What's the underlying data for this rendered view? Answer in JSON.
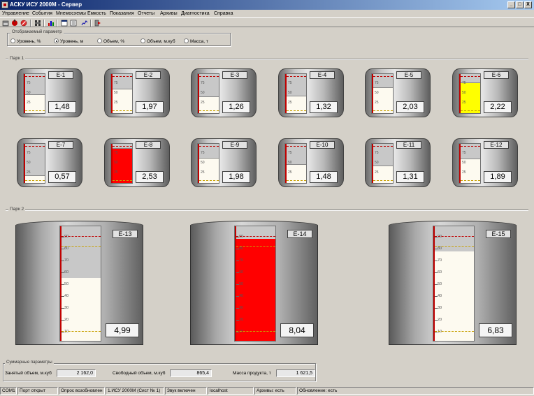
{
  "window": {
    "title": "АСКУ ИСУ 2000М - Сервер",
    "buttons": [
      "_",
      "□",
      "X"
    ]
  },
  "menu": [
    "Управление",
    "События",
    "Мнемосхемы",
    "Емкость",
    "Показания",
    "Отчеты",
    "Архивы",
    "Диагностика",
    "Справка"
  ],
  "toolbar_icons": [
    "tank-icon",
    "red-circle-icon",
    "stop-icon",
    "tools-icon",
    "chart-bars-icon",
    "window-icon",
    "panel-icon",
    "graph-icon",
    "exit-icon"
  ],
  "param_group": {
    "legend": "Отображаемый параметр",
    "options": [
      {
        "label": "Уровень, %",
        "checked": false
      },
      {
        "label": "Уровень, м",
        "checked": true
      },
      {
        "label": "Объем, %",
        "checked": false
      },
      {
        "label": "Объем, м.куб",
        "checked": false
      },
      {
        "label": "Масса, т",
        "checked": false
      }
    ]
  },
  "park1_label": "Парк 1",
  "park2_label": "Парк 2",
  "small_ticks": [
    "75",
    "50",
    "25"
  ],
  "big_ticks": [
    "90",
    "80",
    "70",
    "60",
    "50",
    "40",
    "30",
    "20",
    "10"
  ],
  "park1_tanks": [
    {
      "name": "Е-1",
      "value": "1,48",
      "level": 0.48,
      "color": "#fdfaf0"
    },
    {
      "name": "Е-2",
      "value": "1,97",
      "level": 0.62,
      "color": "#fdfaf0"
    },
    {
      "name": "Е-3",
      "value": "1,26",
      "level": 0.42,
      "color": "#fdfaf0"
    },
    {
      "name": "Е-4",
      "value": "1,32",
      "level": 0.44,
      "color": "#fdfaf0"
    },
    {
      "name": "Е-5",
      "value": "2,03",
      "level": 0.66,
      "color": "#fdfaf0"
    },
    {
      "name": "Е-6",
      "value": "2,22",
      "level": 0.78,
      "color": "#ffff00"
    },
    {
      "name": "Е-7",
      "value": "0,57",
      "level": 0.2,
      "color": "#fdfaf0"
    },
    {
      "name": "Е-8",
      "value": "2,53",
      "level": 0.9,
      "color": "#ff0000"
    },
    {
      "name": "Е-9",
      "value": "1,98",
      "level": 0.65,
      "color": "#fdfaf0"
    },
    {
      "name": "Е-10",
      "value": "1,48",
      "level": 0.48,
      "color": "#fdfaf0"
    },
    {
      "name": "Е-11",
      "value": "1,31",
      "level": 0.44,
      "color": "#fdfaf0"
    },
    {
      "name": "Е-12",
      "value": "1,89",
      "level": 0.62,
      "color": "#fdfaf0"
    }
  ],
  "park2_tanks": [
    {
      "name": "Е-13",
      "value": "4,99",
      "level": 0.55,
      "color": "#fdfaf0"
    },
    {
      "name": "Е-14",
      "value": "8,04",
      "level": 0.89,
      "color": "#ff0000"
    },
    {
      "name": "Е-15",
      "value": "6,83",
      "level": 0.78,
      "color": "#fdfaf0"
    }
  ],
  "summary": {
    "legend": "Суммарные параметры",
    "occupied_label": "Занятый объем, м.куб",
    "occupied_value": "2 162,0",
    "free_label": "Свободный объем, м.куб",
    "free_value": "865,4",
    "mass_label": "Масса продукта, т",
    "mass_value": "1 621,5"
  },
  "status": [
    "COM1",
    "Порт открыт",
    "Опрос возобновлен",
    "1.ИСУ 2000М (Сист № 1)",
    "Звук включен",
    "localhost",
    "Архивы: есть",
    "Обновление: есть"
  ]
}
